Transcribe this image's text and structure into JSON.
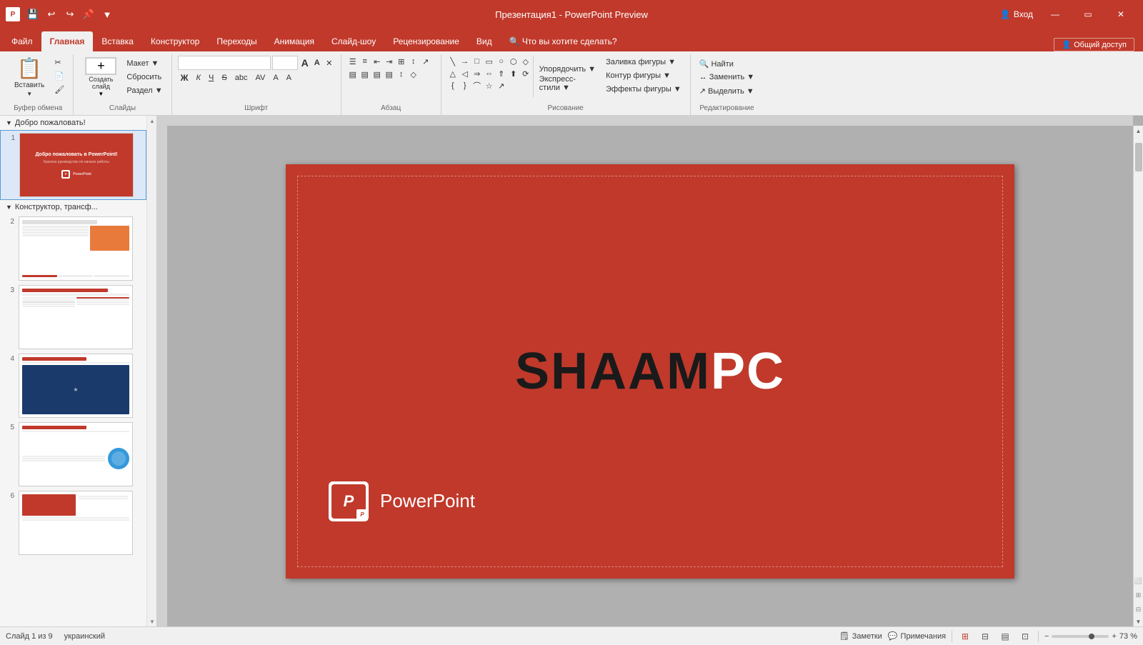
{
  "titleBar": {
    "appName": "Презентация1",
    "separator": " - ",
    "preview": "PowerPoint Preview",
    "signIn": "Вход",
    "tools": [
      "💾",
      "↩",
      "↪",
      "📌",
      "▼"
    ],
    "windowBtns": [
      "—",
      "⧉",
      "✕"
    ]
  },
  "ribbonTabs": {
    "tabs": [
      {
        "label": "Файл",
        "active": false
      },
      {
        "label": "Главная",
        "active": true
      },
      {
        "label": "Вставка",
        "active": false
      },
      {
        "label": "Конструктор",
        "active": false
      },
      {
        "label": "Переходы",
        "active": false
      },
      {
        "label": "Анимация",
        "active": false
      },
      {
        "label": "Слайд-шоу",
        "active": false
      },
      {
        "label": "Рецензирование",
        "active": false
      },
      {
        "label": "Вид",
        "active": false
      },
      {
        "label": "🔍 Что вы хотите сделать?",
        "active": false
      }
    ],
    "shareBtn": "Общий доступ"
  },
  "ribbon": {
    "groups": [
      {
        "name": "Буфер обмена",
        "buttons": [
          "Вставить",
          "Создать слайд"
        ],
        "smallButtons": [
          "Макет ▼",
          "Сбросить",
          "Раздел ▼"
        ]
      },
      {
        "name": "Слайды"
      },
      {
        "name": "Шрифт",
        "fontName": "",
        "fontSize": "",
        "formatBtns": [
          "Ж",
          "К",
          "Ч",
          "S",
          "abc",
          "AV",
          "А",
          "A",
          "▲"
        ]
      },
      {
        "name": "Абзац"
      },
      {
        "name": "Рисование"
      },
      {
        "name": "Редактирование",
        "buttons": [
          "Найти",
          "Заменить ▼",
          "Выделить ▼"
        ]
      }
    ]
  },
  "slidePanel": {
    "sections": [
      {
        "title": "Добро пожаловать!",
        "slides": [
          {
            "num": 1,
            "type": "red"
          }
        ]
      },
      {
        "title": "Конструктор, трансф...",
        "slides": [
          {
            "num": 2,
            "type": "white-content"
          },
          {
            "num": 3,
            "type": "white-content"
          },
          {
            "num": 4,
            "type": "white-space"
          },
          {
            "num": 5,
            "type": "white-circle"
          },
          {
            "num": 6,
            "type": "white-red"
          }
        ]
      }
    ]
  },
  "mainSlide": {
    "bgColor": "#c0392b",
    "logoText": "PowerPoint",
    "brandText": {
      "black": "SHAAM",
      "white": "PC"
    }
  },
  "statusBar": {
    "slideInfo": "Слайд 1 из 9",
    "language": "украинский",
    "notes": "Заметки",
    "comments": "Примечания",
    "zoom": "73 %",
    "viewBtns": [
      "⊞",
      "⊟",
      "▤",
      "⊡"
    ]
  }
}
